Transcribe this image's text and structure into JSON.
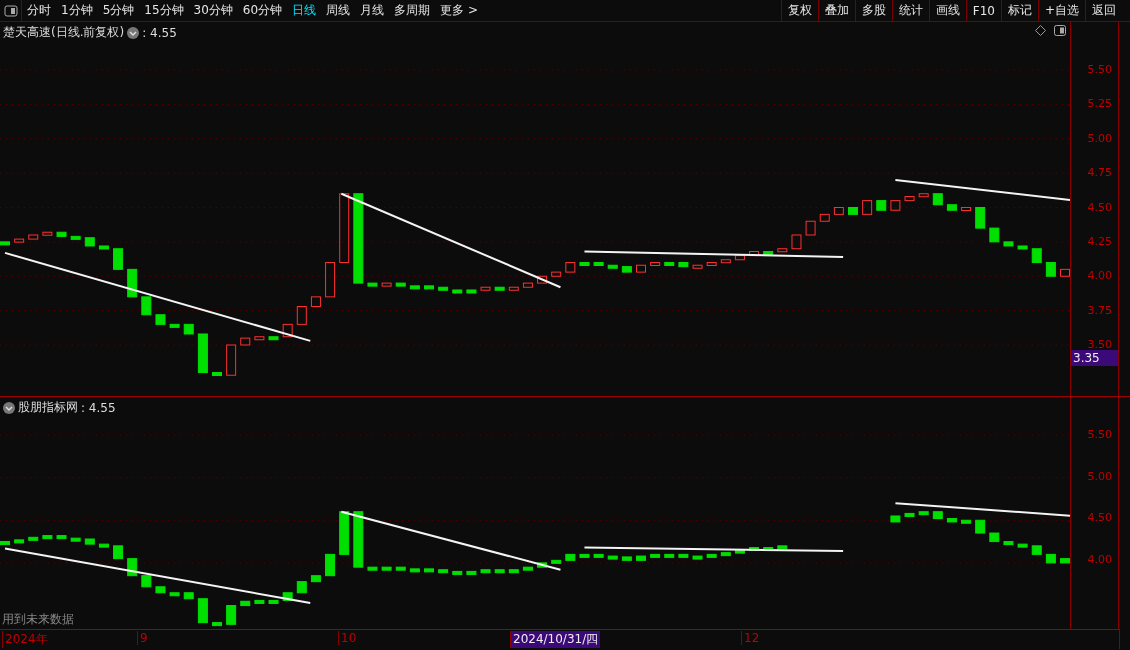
{
  "toolbar": {
    "periods": [
      {
        "label": "分时",
        "selected": false
      },
      {
        "label": "1分钟",
        "selected": false
      },
      {
        "label": "5分钟",
        "selected": false
      },
      {
        "label": "15分钟",
        "selected": false
      },
      {
        "label": "30分钟",
        "selected": false
      },
      {
        "label": "60分钟",
        "selected": false
      },
      {
        "label": "日线",
        "selected": true
      },
      {
        "label": "周线",
        "selected": false
      },
      {
        "label": "月线",
        "selected": false
      },
      {
        "label": "多周期",
        "selected": false
      },
      {
        "label": "更多 >",
        "selected": false
      }
    ],
    "buttons": [
      "复权",
      "叠加",
      "多股",
      "统计",
      "画线",
      "F10",
      "标记",
      "+自选",
      "返回"
    ]
  },
  "main_panel": {
    "title": "楚天高速(日线.前复权)",
    "value": ": 4.55",
    "price_tag": "3.35",
    "y_axis": [
      "5.50",
      "5.25",
      "5.00",
      "4.75",
      "4.50",
      "4.25",
      "4.00",
      "3.75",
      "3.50"
    ]
  },
  "lower_panel": {
    "title": "股朋指标网",
    "value": ": 4.55",
    "note": "用到未来数据",
    "y_axis": [
      "5.50",
      "5.00",
      "4.50",
      "4.00"
    ]
  },
  "date_axis": [
    {
      "label": "2024年",
      "selected": false
    },
    {
      "label": "9",
      "selected": false
    },
    {
      "label": "10",
      "selected": false
    },
    {
      "label": "2024/10/31/四",
      "selected": true
    },
    {
      "label": "12",
      "selected": false
    }
  ]
}
